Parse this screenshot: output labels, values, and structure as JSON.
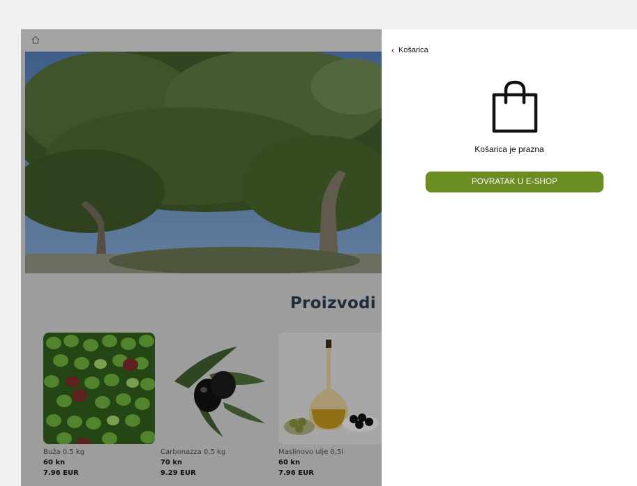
{
  "site": {
    "section_title": "Proizvodi",
    "products": [
      {
        "name": "Buža 0.5 kg",
        "price_kn": "60 kn",
        "price_eur": "7.96 EUR"
      },
      {
        "name": "Carbonazza 0.5 kg",
        "price_kn": "70 kn",
        "price_eur": "9.29 EUR"
      },
      {
        "name": "Maslinovo ulje 0,5l",
        "price_kn": "60 kn",
        "price_eur": "7.96 EUR"
      }
    ]
  },
  "cart": {
    "back_label": "Košarica",
    "empty_message": "Košarica je prazna",
    "return_button": "POVRATAK U E-SHOP",
    "accent_color": "#6a8e21"
  },
  "icons": {
    "home": "home-icon",
    "back": "chevron-left-icon",
    "bag": "shopping-bag-icon"
  }
}
